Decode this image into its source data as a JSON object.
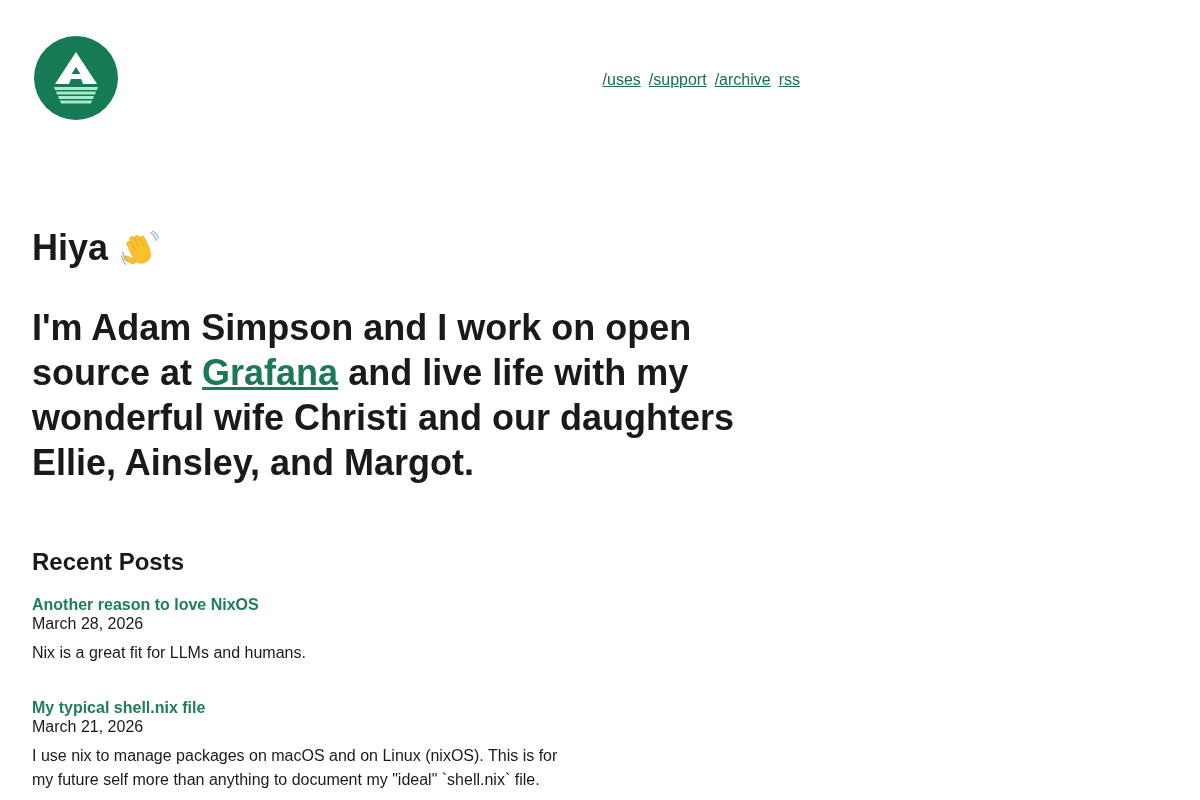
{
  "nav": [
    "/uses",
    "/support",
    "/archive",
    "rss"
  ],
  "greeting": "Hiya",
  "intro": {
    "before": "I'm Adam Simpson and I work on open source at",
    "link": "Grafana",
    "after": "and live life with my wonderful wife Christi and our daughters Ellie, Ainsley, and Margot."
  },
  "recent_posts": {
    "title": "Recent Posts",
    "posts": [
      {
        "title": "Another reason to love NixOS",
        "date": "March 28, 2026",
        "excerpt": "Nix is a great fit for LLMs and humans."
      },
      {
        "title": "My typical shell.nix file",
        "date": "March 21, 2026",
        "excerpt": "I use nix to manage packages on macOS and on Linux (nixOS). This is for my future self more than anything to document my \"ideal\" `shell.nix` file."
      }
    ]
  }
}
